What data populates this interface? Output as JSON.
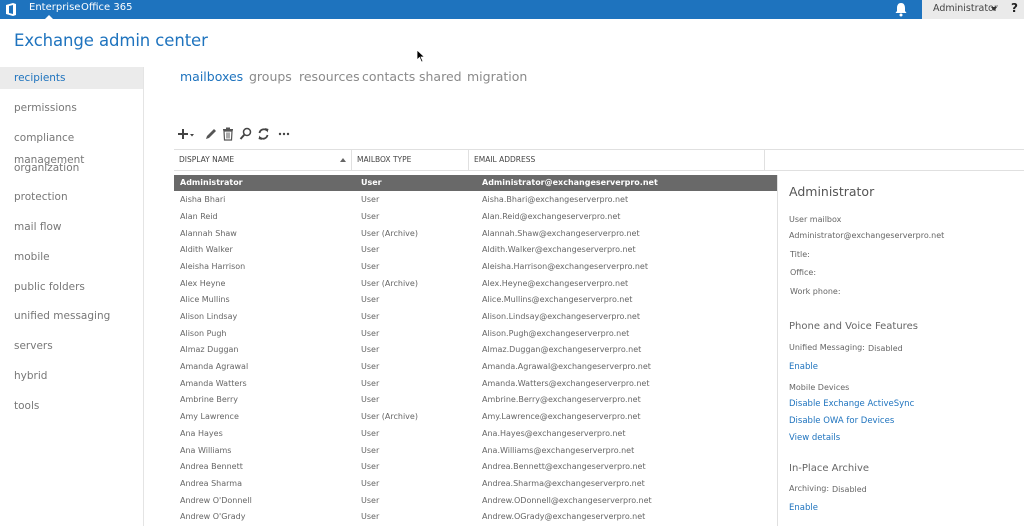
{
  "topbar": {
    "logo_icon": "office-logo-icon",
    "nav": [
      "Enterprise",
      "Office 365"
    ],
    "notification_icon": "bell-icon",
    "user": "Administrator",
    "help": "?"
  },
  "app_title": "Exchange admin center",
  "sidebar": {
    "items": [
      {
        "label": "recipients",
        "active": true
      },
      {
        "label": "permissions"
      },
      {
        "label": "compliance management"
      },
      {
        "label": "organization"
      },
      {
        "label": "protection"
      },
      {
        "label": "mail flow"
      },
      {
        "label": "mobile"
      },
      {
        "label": "public folders"
      },
      {
        "label": "unified messaging"
      },
      {
        "label": "servers"
      },
      {
        "label": "hybrid"
      },
      {
        "label": "tools"
      }
    ]
  },
  "tabs": [
    {
      "label": "mailboxes",
      "active": true
    },
    {
      "label": "groups"
    },
    {
      "label": "resources"
    },
    {
      "label": "contacts"
    },
    {
      "label": "shared"
    },
    {
      "label": "migration"
    }
  ],
  "toolbar": {
    "icons": [
      "add-icon",
      "edit-icon",
      "delete-icon",
      "search-icon",
      "refresh-icon",
      "more-icon"
    ]
  },
  "grid": {
    "columns": [
      "DISPLAY NAME",
      "MAILBOX TYPE",
      "EMAIL ADDRESS"
    ],
    "sort_column": "DISPLAY NAME",
    "sort_direction": "ascending",
    "rows": [
      {
        "name": "Administrator",
        "type": "User",
        "email": "Administrator@exchangeserverpro.net",
        "selected": true
      },
      {
        "name": "Aisha Bhari",
        "type": "User",
        "email": "Aisha.Bhari@exchangeserverpro.net"
      },
      {
        "name": "Alan Reid",
        "type": "User",
        "email": "Alan.Reid@exchangeserverpro.net"
      },
      {
        "name": "Alannah Shaw",
        "type": "User (Archive)",
        "email": "Alannah.Shaw@exchangeserverpro.net"
      },
      {
        "name": "Aldith Walker",
        "type": "User",
        "email": "Aldith.Walker@exchangeserverpro.net"
      },
      {
        "name": "Aleisha Harrison",
        "type": "User",
        "email": "Aleisha.Harrison@exchangeserverpro.net"
      },
      {
        "name": "Alex Heyne",
        "type": "User (Archive)",
        "email": "Alex.Heyne@exchangeserverpro.net"
      },
      {
        "name": "Alice Mullins",
        "type": "User",
        "email": "Alice.Mullins@exchangeserverpro.net"
      },
      {
        "name": "Alison Lindsay",
        "type": "User",
        "email": "Alison.Lindsay@exchangeserverpro.net"
      },
      {
        "name": "Alison Pugh",
        "type": "User",
        "email": "Alison.Pugh@exchangeserverpro.net"
      },
      {
        "name": "Almaz Duggan",
        "type": "User",
        "email": "Almaz.Duggan@exchangeserverpro.net"
      },
      {
        "name": "Amanda Agrawal",
        "type": "User",
        "email": "Amanda.Agrawal@exchangeserverpro.net"
      },
      {
        "name": "Amanda Watters",
        "type": "User",
        "email": "Amanda.Watters@exchangeserverpro.net"
      },
      {
        "name": "Ambrine Berry",
        "type": "User",
        "email": "Ambrine.Berry@exchangeserverpro.net"
      },
      {
        "name": "Amy Lawrence",
        "type": "User (Archive)",
        "email": "Amy.Lawrence@exchangeserverpro.net"
      },
      {
        "name": "Ana Hayes",
        "type": "User",
        "email": "Ana.Hayes@exchangeserverpro.net"
      },
      {
        "name": "Ana Williams",
        "type": "User",
        "email": "Ana.Williams@exchangeserverpro.net"
      },
      {
        "name": "Andrea Bennett",
        "type": "User",
        "email": "Andrea.Bennett@exchangeserverpro.net"
      },
      {
        "name": "Andrea Sharma",
        "type": "User",
        "email": "Andrea.Sharma@exchangeserverpro.net"
      },
      {
        "name": "Andrew O'Donnell",
        "type": "User",
        "email": "Andrew.ODonnell@exchangeserverpro.net"
      },
      {
        "name": "Andrew O'Grady",
        "type": "User",
        "email": "Andrew.OGrady@exchangeserverpro.net"
      }
    ]
  },
  "details": {
    "title": "Administrator",
    "mailbox_type": "User mailbox",
    "email": "Administrator@exchangeserverpro.net",
    "title_label": "Title:",
    "office_label": "Office:",
    "work_phone_label": "Work phone:",
    "phone_voice_heading": "Phone and Voice Features",
    "um_label": "Unified Messaging:",
    "um_value": "Disabled",
    "um_enable_link": "Enable",
    "mobile_devices_label": "Mobile Devices",
    "disable_eas_link": "Disable Exchange ActiveSync",
    "disable_owa_link": "Disable OWA for Devices",
    "view_details_link": "View details",
    "archive_heading": "In-Place Archive",
    "archiving_label": "Archiving:",
    "archiving_value": "Disabled",
    "archive_enable_link": "Enable"
  },
  "colors": {
    "brand_blue": "#1e73be",
    "selected_row": "#696969"
  }
}
